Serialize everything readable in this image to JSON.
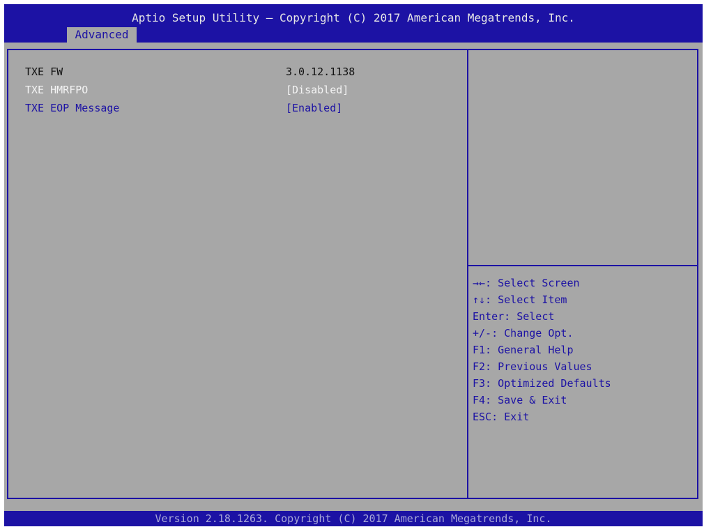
{
  "header": {
    "title": "Aptio Setup Utility – Copyright (C) 2017 American Megatrends, Inc.",
    "tab": "Advanced"
  },
  "settings": [
    {
      "label": "TXE FW",
      "value": "3.0.12.1138",
      "state": "static"
    },
    {
      "label": "TXE HMRFPO",
      "value": "[Disabled]",
      "state": "selected"
    },
    {
      "label": "TXE EOP Message",
      "value": "[Enabled]",
      "state": "option"
    }
  ],
  "help": [
    "→←: Select Screen",
    "↑↓: Select Item",
    "Enter: Select",
    "+/-: Change Opt.",
    "F1: General Help",
    "F2: Previous Values",
    "F3: Optimized Defaults",
    "F4: Save & Exit",
    "ESC: Exit"
  ],
  "footer": {
    "text": "Version 2.18.1263. Copyright (C) 2017 American Megatrends, Inc."
  },
  "colors": {
    "header_bg": "#1c12a4",
    "screen_bg": "#a7a7a7",
    "selected_text": "#f4f4f4",
    "option_text": "#1c12a4"
  }
}
